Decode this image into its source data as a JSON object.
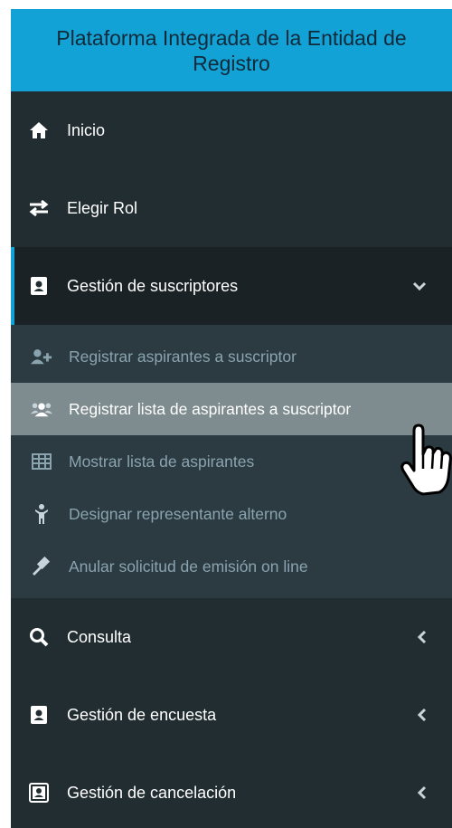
{
  "header": {
    "title": "Plataforma Integrada de la Entidad de Registro"
  },
  "menu": {
    "inicio": "Inicio",
    "elegir_rol": "Elegir Rol",
    "gestion_suscriptores": "Gestión de suscriptores",
    "consulta": "Consulta",
    "gestion_encuesta": "Gestión de encuesta",
    "gestion_cancelacion": "Gestión de cancelación"
  },
  "submenu": {
    "registrar_aspirantes": "Registrar aspirantes a suscriptor",
    "registrar_lista": "Registrar lista de aspirantes a suscriptor",
    "mostrar_lista": "Mostrar lista de aspirantes",
    "designar": "Designar representante alterno",
    "anular": "Anular solicitud de emisión on line"
  },
  "colors": {
    "header": "#13a2d6",
    "sidebar": "#222d32",
    "submenu": "#2c3b41",
    "hover": "#7f8c8f"
  },
  "icons": [
    "home-icon",
    "exchange-icon",
    "id-card-icon",
    "chevron-down-icon",
    "user-plus-icon",
    "users-icon",
    "table-icon",
    "child-icon",
    "gavel-icon",
    "search-icon",
    "chevron-left-icon",
    "hand-pointer-icon"
  ]
}
